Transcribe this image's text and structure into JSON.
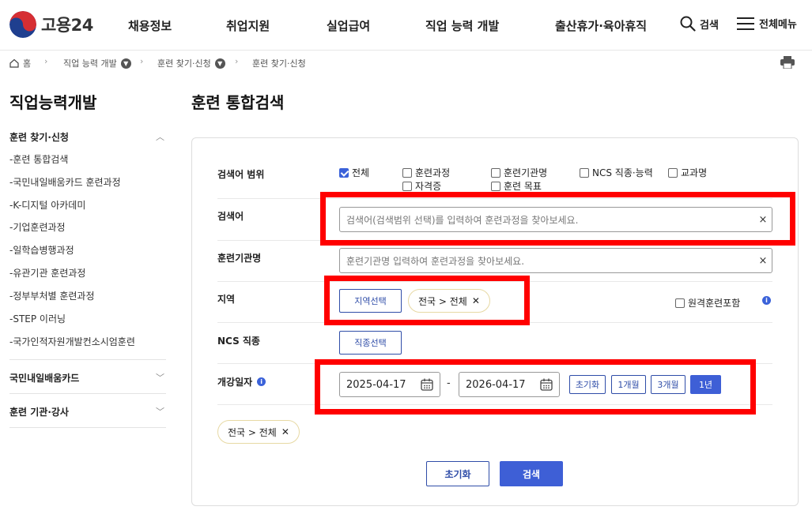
{
  "header": {
    "logo_text": "고용24",
    "nav": [
      "채용정보",
      "취업지원",
      "실업급여",
      "직업 능력 개발",
      "출산휴가·육아휴직"
    ],
    "search_label": "검색",
    "menu_label": "전체메뉴"
  },
  "breadcrumb": {
    "home": "홈",
    "items": [
      "직업 능력 개발",
      "훈련 찾기·신청",
      "훈련 찾기·신청"
    ]
  },
  "sidebar": {
    "title": "직업능력개발",
    "group1": "훈련 찾기·신청",
    "items": [
      "-훈련 통합검색",
      "-국민내일배움카드 훈련과정",
      "-K-디지털 아카데미",
      "-기업훈련과정",
      "-일학습병행과정",
      "-유관기관 훈련과정",
      "-정부부처별 훈련과정",
      "-STEP 이러닝",
      "-국가인적자원개발컨소시엄훈련"
    ],
    "group2": "국민내일배움카드",
    "group3": "훈련 기관·강사"
  },
  "main": {
    "title": "훈련 통합검색",
    "scope": {
      "label": "검색어 범위",
      "options": [
        {
          "label": "전체",
          "checked": true
        },
        {
          "label": "훈련과정",
          "checked": false
        },
        {
          "label": "훈련기관명",
          "checked": false
        },
        {
          "label": "NCS 직종·능력",
          "checked": false
        },
        {
          "label": "교과명",
          "checked": false
        },
        {
          "label": "자격증",
          "checked": false
        },
        {
          "label": "훈련 목표",
          "checked": false
        }
      ]
    },
    "keyword": {
      "label": "검색어",
      "placeholder": "검색어(검색범위 선택)를 입력하여 훈련과정을 찾아보세요.",
      "clear": "×"
    },
    "institution": {
      "label": "훈련기관명",
      "placeholder": "훈련기관명 입력하여 훈련과정을 찾아보세요.",
      "clear": "×"
    },
    "region": {
      "label": "지역",
      "button": "지역선택",
      "chip": "전국 > 전체",
      "remote_label": "원격훈련포함"
    },
    "ncs": {
      "label": "NCS 직종",
      "button": "직종선택"
    },
    "date": {
      "label": "개강일자",
      "start": "2025-04-17",
      "end": "2026-04-17",
      "dash": "-",
      "presets": [
        {
          "label": "초기화",
          "active": false
        },
        {
          "label": "1개월",
          "active": false
        },
        {
          "label": "3개월",
          "active": false
        },
        {
          "label": "1년",
          "active": true
        }
      ]
    },
    "selected_chip": "전국 > 전체",
    "reset_button": "초기화",
    "search_button": "검색"
  },
  "colors": {
    "accent": "#3e5fd6",
    "highlight": "#ff0000",
    "chip_border": "#e7d9a4"
  }
}
